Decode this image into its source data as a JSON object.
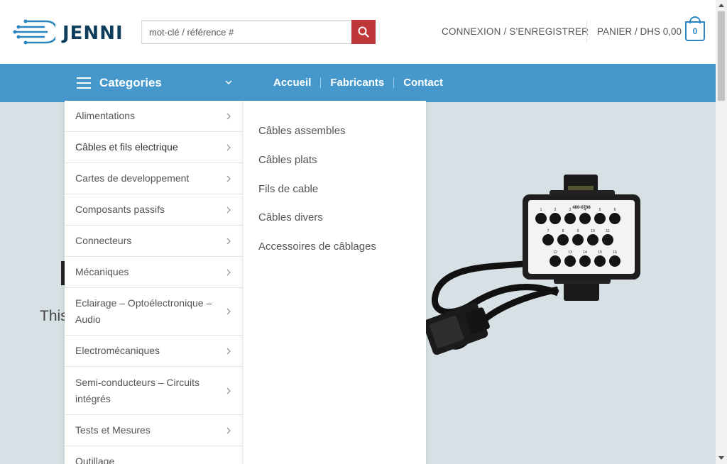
{
  "brand": {
    "logo_text": "JENNI",
    "accent_color": "#4597cc",
    "search_button_color": "#c0373a"
  },
  "search": {
    "placeholder": "mot-clé / référence #",
    "icon": "search-icon"
  },
  "header": {
    "account_label": "CONNEXION / S'ENREGISTRER",
    "cart_label": "PANIER / DHS 0,00",
    "cart_count": "0"
  },
  "nav": {
    "categories_label": "Categories",
    "links": [
      {
        "label": "Accueil"
      },
      {
        "label": "Fabricants"
      },
      {
        "label": "Contact"
      }
    ]
  },
  "menu": {
    "items": [
      {
        "label": "Alimentations"
      },
      {
        "label": "Câbles et fils electrique"
      },
      {
        "label": "Cartes de developpement"
      },
      {
        "label": "Composants passifs"
      },
      {
        "label": "Connecteurs"
      },
      {
        "label": "Mécaniques"
      },
      {
        "label": "Eclairage – Optoélectronique – Audio"
      },
      {
        "label": "Electromécaniques"
      },
      {
        "label": "Semi-conducteurs – Circuits intégrés"
      },
      {
        "label": "Tests et Mesures"
      },
      {
        "label": "Outillage"
      }
    ],
    "submenu": [
      {
        "label": "Câbles assembles"
      },
      {
        "label": "Câbles plats"
      },
      {
        "label": "Fils de cable"
      },
      {
        "label": "Câbles divers"
      },
      {
        "label": "Accessoires de câblages"
      }
    ]
  },
  "hero": {
    "text": "This",
    "product_label": "400-0708",
    "port_numbers": [
      "1",
      "2",
      "3",
      "4",
      "5",
      "6",
      "7",
      "8",
      "9",
      "10",
      "11",
      "12",
      "13",
      "14",
      "15",
      "16"
    ]
  }
}
